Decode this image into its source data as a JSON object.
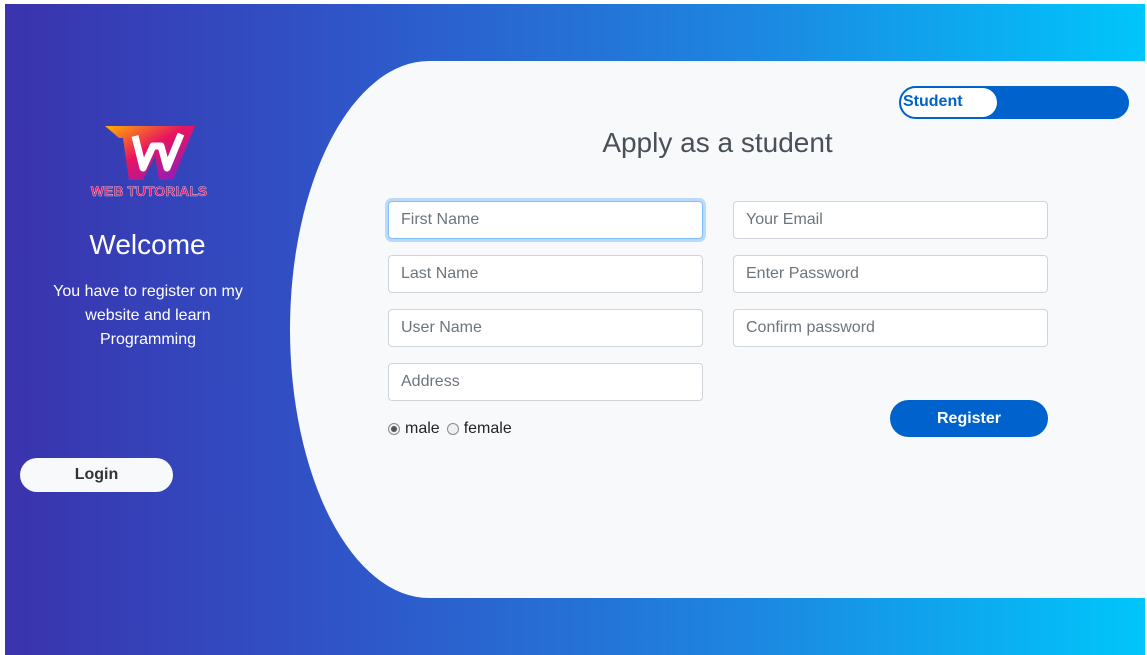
{
  "sidebar": {
    "logo_text": "WEB TUTORIALS",
    "welcome": "Welcome",
    "subtitle": "You have to register on my website and learn Programming",
    "login_label": "Login"
  },
  "form": {
    "toggle_label": "Student",
    "heading": "Apply as a student",
    "first_name_placeholder": "First Name",
    "last_name_placeholder": "Last Name",
    "user_name_placeholder": "User Name",
    "address_placeholder": "Address",
    "email_placeholder": "Your Email",
    "password_placeholder": "Enter Password",
    "confirm_placeholder": "Confirm password",
    "gender_options": [
      "male",
      "female"
    ],
    "gender_selected": "male",
    "register_label": "Register"
  },
  "colors": {
    "primary": "#0062cc",
    "gradient_start": "#3a33ad",
    "gradient_end": "#00c6fb",
    "card_bg": "#f8f9fa"
  }
}
